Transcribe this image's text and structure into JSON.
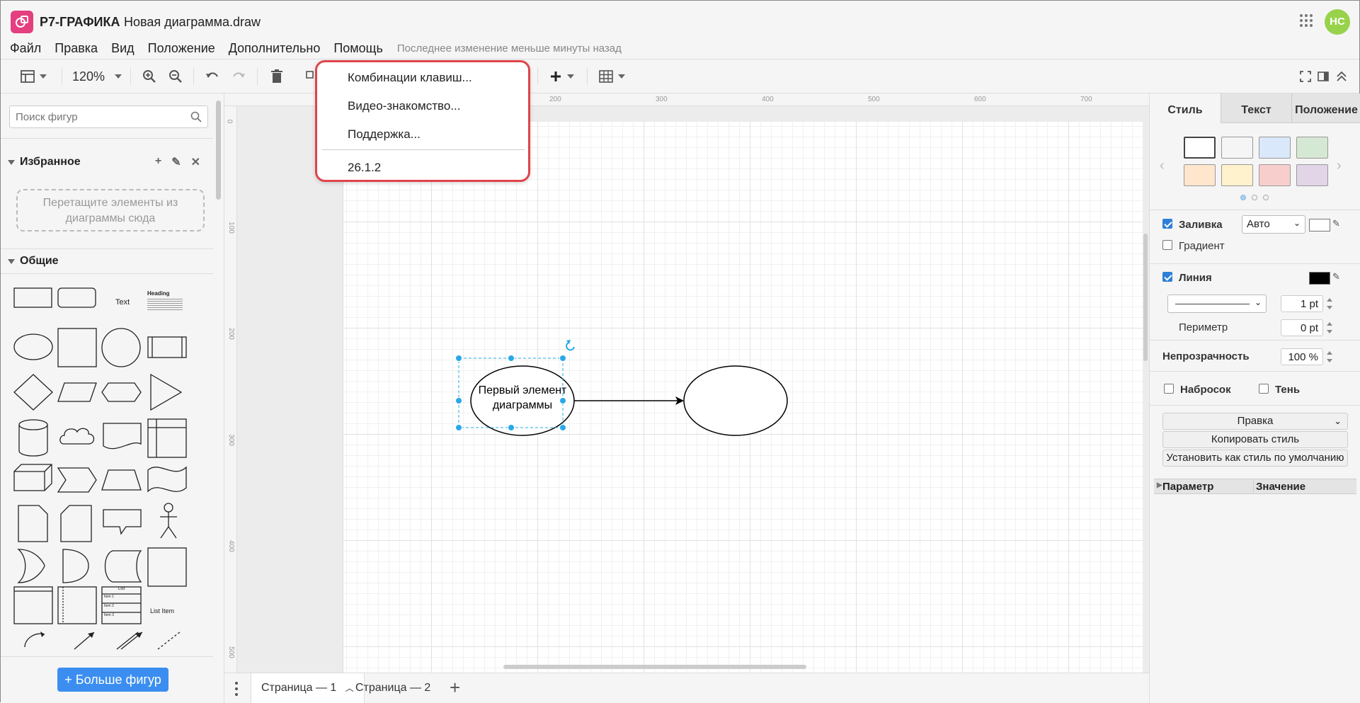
{
  "app": {
    "name": "Р7-ГРАФИКА",
    "document": "Новая диаграмма.draw",
    "user_initials": "НС"
  },
  "menu": {
    "items": [
      "Файл",
      "Правка",
      "Вид",
      "Положение",
      "Дополнительно",
      "Помощь"
    ],
    "status": "Последнее изменение меньше минуты назад"
  },
  "toolbar": {
    "zoom": "120%"
  },
  "help_menu": {
    "items": [
      "Комбинации клавиш...",
      "Видео-знакомство...",
      "Поддержка..."
    ],
    "version": "26.1.2"
  },
  "sidebar": {
    "search_placeholder": "Поиск фигур",
    "favorites_title": "Избранное",
    "dropzone_text": "Перетащите элементы из диаграммы сюда",
    "general_title": "Общие",
    "shape_labels": {
      "text": "Text",
      "heading": "Heading",
      "list": "List",
      "list_item": "List Item",
      "item1": "Item 1",
      "item2": "Item 2",
      "item3": "Item 3"
    },
    "more_shapes": "Больше фигур"
  },
  "ruler": {
    "top": [
      "200",
      "300",
      "400",
      "500",
      "600",
      "700"
    ],
    "left": [
      "0",
      "100",
      "200",
      "300",
      "400",
      "500"
    ]
  },
  "diagram": {
    "node1_line1": "Первый элемент",
    "node1_line2": "диаграммы"
  },
  "pages": {
    "tabs": [
      "Страница — 1",
      "Страница — 2"
    ]
  },
  "format_panel": {
    "tabs": [
      "Стиль",
      "Текст",
      "Положение"
    ],
    "swatches": [
      "#ffffff",
      "#f5f5f5",
      "#dae8fc",
      "#d5e8d4",
      "#ffe6cc",
      "#fff2cc",
      "#f8cecc",
      "#e1d5e7"
    ],
    "fill_label": "Заливка",
    "fill_value": "Авто",
    "gradient_label": "Градиент",
    "line_label": "Линия",
    "line_width": "1 pt",
    "perimeter_label": "Периметр",
    "perimeter_value": "0 pt",
    "opacity_label": "Непрозрачность",
    "opacity_value": "100 %",
    "sketch_label": "Набросок",
    "shadow_label": "Тень",
    "edit_button": "Правка",
    "copy_style": "Копировать стиль",
    "set_default": "Установить как стиль по умолчанию",
    "param_col": "Параметр",
    "value_col": "Значение"
  }
}
